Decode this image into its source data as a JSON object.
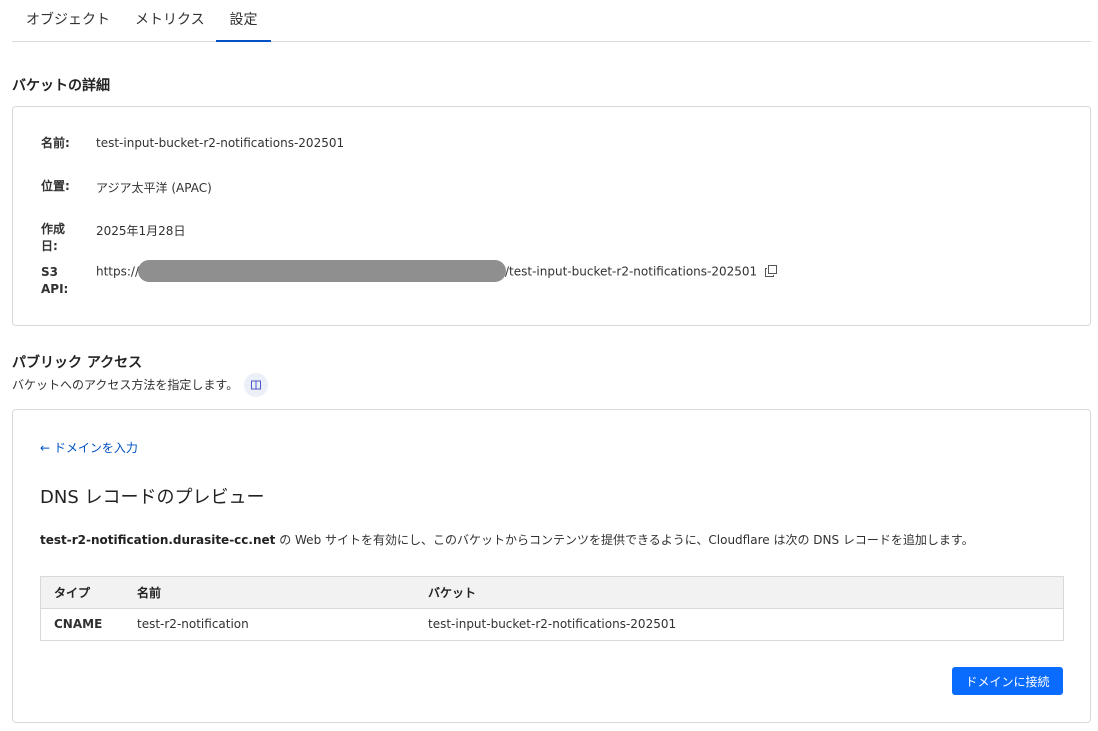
{
  "tabs": [
    {
      "label": "オブジェクト"
    },
    {
      "label": "メトリクス"
    },
    {
      "label": "設定"
    }
  ],
  "bucket_details": {
    "title": "バケットの詳細",
    "rows": [
      {
        "label": "名前:",
        "value": "test-input-bucket-r2-notifications-202501"
      },
      {
        "label": "位置:",
        "value": "アジア太平洋 (APAC)"
      },
      {
        "label": "作成日:",
        "value": "2025年1月28日"
      },
      {
        "label": "S3 API:",
        "value_prefix": "https://",
        "value_suffix": "/test-input-bucket-r2-notifications-202501"
      }
    ]
  },
  "public_access": {
    "title": "パブリック アクセス",
    "description": "バケットへのアクセス方法を指定します。",
    "back_link": "← ドメインを入力",
    "preview_title": "DNS レコードのプレビュー",
    "preview_domain": "test-r2-notification.durasite-cc.net",
    "preview_text": " の Web サイトを有効にし、このバケットからコンテンツを提供できるように、Cloudflare は次の DNS レコードを追加します。",
    "table": {
      "headers": [
        "タイプ",
        "名前",
        "バケット"
      ],
      "rows": [
        [
          "CNAME",
          "test-r2-notification",
          "test-input-bucket-r2-notifications-202501"
        ]
      ]
    },
    "connect_button": "ドメインに接続"
  },
  "colors": {
    "accent": "#0051c3",
    "button": "#0a6cff"
  }
}
